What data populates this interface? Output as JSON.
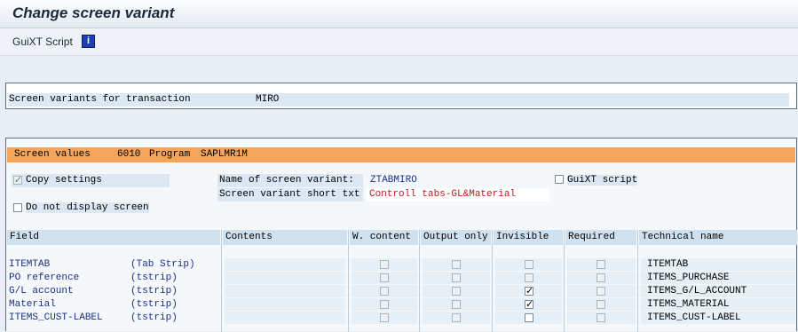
{
  "window": {
    "title": "Change screen variant"
  },
  "toolbar": {
    "guixt_script": "GuiXT Script",
    "info_icon": "i"
  },
  "transaction": {
    "label": "Screen variants for transaction",
    "value": "MIRO"
  },
  "screen_values": {
    "label": "Screen values",
    "screen": "6010",
    "program_label": "Program",
    "program": "SAPLMR1M"
  },
  "options": {
    "copy_settings": {
      "label": "Copy settings",
      "checked": true
    },
    "do_not_display": {
      "label": "Do not display screen",
      "checked": false
    },
    "guixt_script": {
      "label": "GuiXT script",
      "checked": false
    }
  },
  "variant": {
    "name_label": "Name of screen variant:",
    "name_value": "ZTABMIRO",
    "short_label": "Screen variant short txt",
    "short_value": "Controll tabs-GL&Material"
  },
  "table": {
    "headers": [
      "Field",
      "Contents",
      "W. content",
      "Output only",
      "Invisible",
      "Required",
      "Technical name"
    ],
    "rows": [
      {
        "field": "ITEMTAB",
        "type": "(Tab Strip)",
        "contents": "",
        "w_content": false,
        "output_only": false,
        "invisible": false,
        "required": false,
        "technical": "ITEMTAB"
      },
      {
        "field": "PO reference",
        "type": "(tstrip)",
        "contents": "",
        "w_content": false,
        "output_only": false,
        "invisible": false,
        "required": false,
        "technical": "ITEMS_PURCHASE"
      },
      {
        "field": "G/L account",
        "type": "(tstrip)",
        "contents": "",
        "w_content": false,
        "output_only": false,
        "invisible": true,
        "required": false,
        "technical": "ITEMS_G/L_ACCOUNT"
      },
      {
        "field": "Material",
        "type": "(tstrip)",
        "contents": "",
        "w_content": false,
        "output_only": false,
        "invisible": true,
        "required": false,
        "technical": "ITEMS_MATERIAL"
      },
      {
        "field": "ITEMS_CUST-LABEL",
        "type": "(tstrip)",
        "contents": "",
        "w_content": false,
        "output_only": false,
        "invisible": false,
        "required": false,
        "technical": "ITEMS_CUST-LABEL"
      }
    ]
  }
}
